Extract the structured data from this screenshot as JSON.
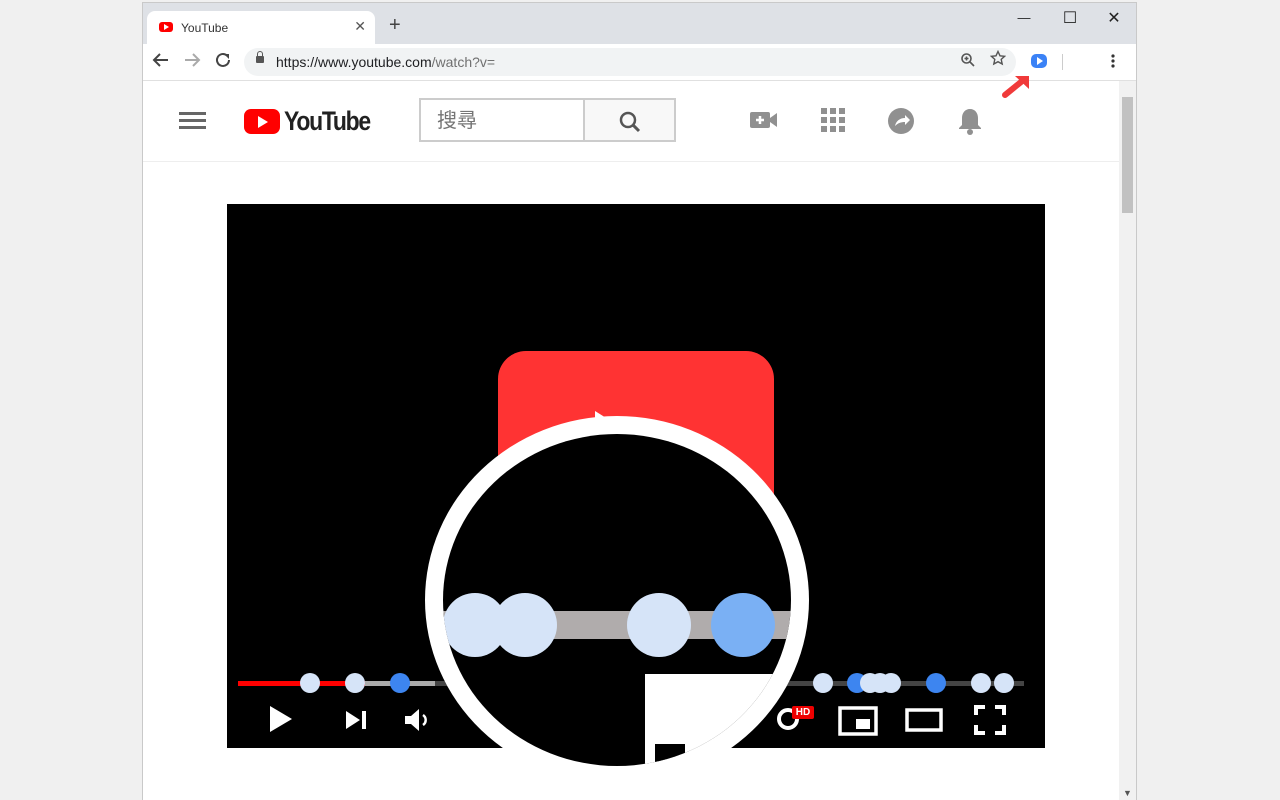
{
  "browser": {
    "tab_title": "YouTube",
    "tab_close": "✕",
    "new_tab": "+",
    "window_controls": {
      "minimize": "—",
      "maximize": "☐",
      "close": "✕"
    },
    "url_main": "https://www.youtube.com",
    "url_rest": "/watch?v=",
    "icons": [
      "back-icon",
      "forward-icon",
      "reload-icon",
      "lock-icon",
      "zoom-icon",
      "star-icon",
      "extension-icon",
      "menu-kebab-icon"
    ]
  },
  "youtube": {
    "logo_text": "YouTube",
    "search_placeholder": "搜尋",
    "header_icons": [
      "upload-video-icon",
      "apps-grid-icon",
      "share-icon",
      "notifications-bell-icon"
    ]
  },
  "player": {
    "controls": [
      "play-icon",
      "next-icon",
      "volume-icon",
      "settings-icon",
      "miniplayer-icon",
      "theater-mode-icon",
      "fullscreen-icon"
    ],
    "hd_badge": "HD",
    "played_fraction": 0.16,
    "colors": {
      "played": "#ff0000",
      "marker_light": "#d6e4f8",
      "marker_blue": "#3d85f0",
      "big_play": "#ff3333"
    }
  },
  "annotation": {
    "arrow_color": "#f03a3a",
    "magnifier": "zoom-callout"
  }
}
